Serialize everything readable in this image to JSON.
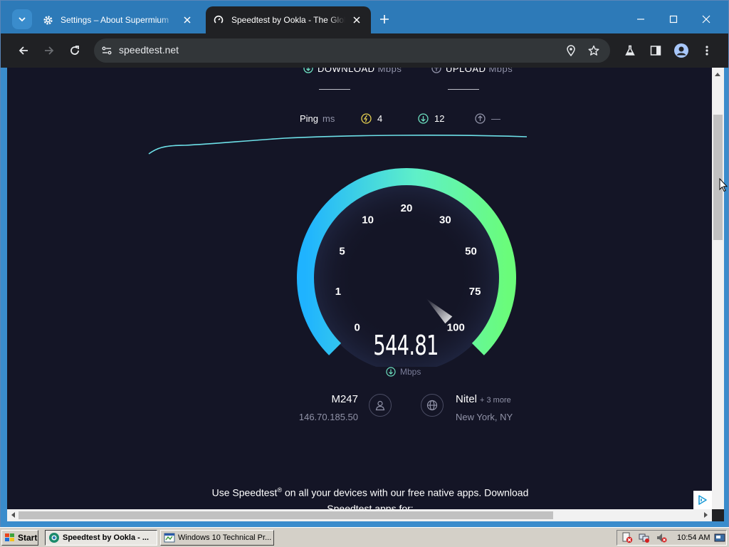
{
  "browser": {
    "tabs": [
      {
        "title": "Settings – About Supermium",
        "icon": "gear-icon",
        "active": false
      },
      {
        "title": "Speedtest by Ookla - The Global Broadband Speed Test",
        "icon": "speedtest-icon",
        "active": true
      }
    ],
    "url": "speedtest.net"
  },
  "speedtest": {
    "download_label": "DOWNLOAD",
    "upload_label": "UPLOAD",
    "unit_mbps": "Mbps",
    "ping_label": "Ping",
    "ping_unit": "ms",
    "ping_idle": "4",
    "ping_download": "12",
    "ping_upload": "—",
    "gauge_labels": [
      "0",
      "1",
      "5",
      "10",
      "20",
      "30",
      "50",
      "75",
      "100"
    ],
    "current_speed": "544.81",
    "current_speed_value": 544.81,
    "speed_unit": "Mbps",
    "isp_name": "M247",
    "isp_ip": "146.70.185.50",
    "server_name": "Nitel",
    "server_more": "+ 3 more",
    "server_location": "New York, NY",
    "promo_pre": "Use Speedtest",
    "promo_reg": "®",
    "promo_post": " on all your devices with our free native apps. Download Speedtest apps for:"
  },
  "colors": {
    "page_bg": "#141526",
    "gauge_start": "#1fb3ff",
    "gauge_end": "#6afc7a",
    "graph_line": "#6de0e8",
    "tab_strip": "#2d7ab8"
  },
  "taskbar": {
    "start_label": "Start",
    "tasks": [
      {
        "label": "Speedtest by Ookla - ...",
        "active": true
      },
      {
        "label": "Windows 10 Technical Pr...",
        "active": false
      }
    ],
    "clock": "10:54 AM"
  }
}
